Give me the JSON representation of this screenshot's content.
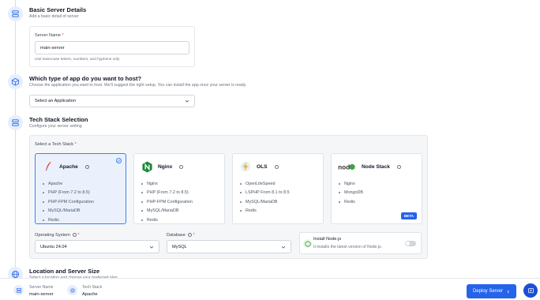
{
  "basic": {
    "title": "Basic Server Details",
    "subtitle": "Add a basic detail of server",
    "server_name_label": "Server Name",
    "server_name_value": "main-server",
    "server_name_hint": "Use lowercase letters, numbers, and hyphens only"
  },
  "app": {
    "title": "Which type of app do you want to host?",
    "subtitle": "Choose the application you want to host. We'll suggest the right setup. You can install the app once your server is ready.",
    "select_value": "Select an Application"
  },
  "stack": {
    "title": "Tech Stack Selection",
    "subtitle": "Configure your server setting",
    "label": "Select a Tech Stack",
    "cards": [
      {
        "name": "Apache",
        "items": [
          "Apache",
          "PHP (From 7.2 to 8.5)",
          "PHP-FPM Configuration",
          "MySQL/MariaDB",
          "Redis"
        ],
        "selected": true
      },
      {
        "name": "Nginx",
        "items": [
          "Nginx",
          "PHP (From 7.2 to 8.5)",
          "PHP-FPM Configuration",
          "MySQL/MariaDB",
          "Redis"
        ],
        "selected": false
      },
      {
        "name": "OLS",
        "items": [
          "OpenLiteSpeed",
          "LSPHP From 8.1 to 8.5",
          "MySQL/MariaDB",
          "Redis"
        ],
        "selected": false
      },
      {
        "name": "Node Stack",
        "items": [
          "Nginx",
          "MongoDB",
          "Redis"
        ],
        "selected": false,
        "badge": "BETA"
      }
    ],
    "os_label": "Operating System",
    "os_value": "Ubuntu 24.04",
    "db_label": "Database",
    "db_value": "MySQL",
    "node_title": "Install Node.js",
    "node_desc": "It installs the latest version of Node.js.",
    "node_enabled": false
  },
  "location": {
    "title": "Location and Server Size",
    "subtitle": "Select a location and choose your preferred plan"
  },
  "summary": {
    "server_label": "Server Name",
    "server_value": "main-server",
    "stack_label": "Tech Stack",
    "stack_value": "Apache",
    "deploy_label": "Deploy Server"
  },
  "colors": {
    "accent": "#2563eb",
    "selected_bg": "#eaf1fd",
    "required": "#ef4444"
  }
}
